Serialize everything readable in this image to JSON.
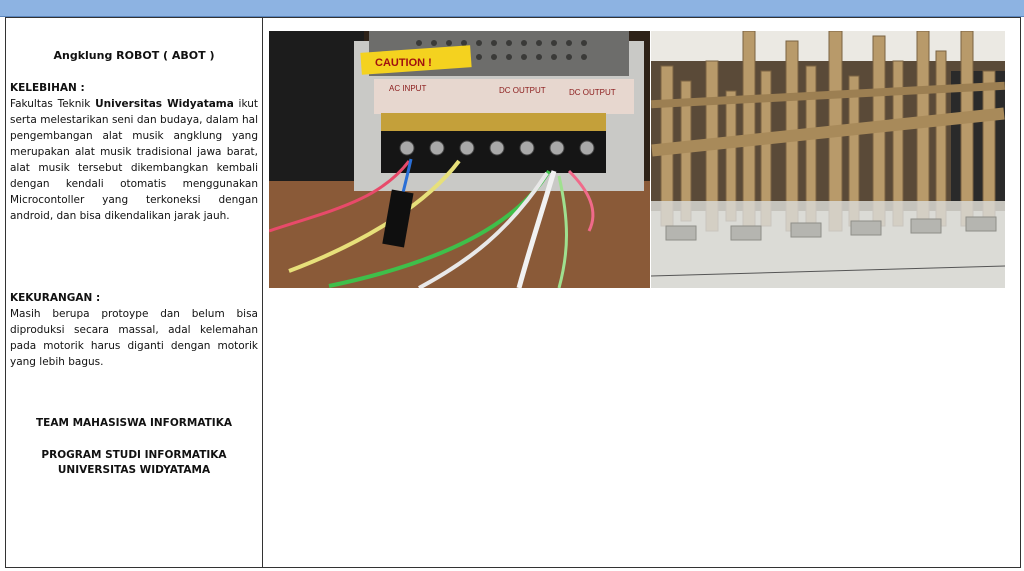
{
  "left_panel": {
    "title": "Angklung ROBOT  ( ABOT )",
    "kelebihan": {
      "heading": "KELEBIHAN  :",
      "text_before": "Fakultas Teknik ",
      "text_bold": "Universitas Widyatama",
      "text_after": " ikut serta melestarikan seni dan budaya, dalam hal pengembangan alat musik angklung  yang merupakan alat musik tradisional jawa barat, alat musik tersebut dikembangkan kembali dengan kendali otomatis  menggunakan Microcontoller yang terkoneksi dengan android, dan bisa dikendalikan jarak jauh."
    },
    "kekurangan": {
      "heading": "KEKURANGAN  :",
      "text": "Masih berupa protoype dan belum bisa diproduksi secara  massal, adal kelemahan pada motorik harus diganti dengan motorik yang lebih bagus."
    },
    "team": "TEAM MAHASISWA INFORMATIKA",
    "prodi_line1": "PROGRAM STUDI  INFORMATIKA",
    "prodi_line2": "UNIVERSITAS WIDYATAMA"
  },
  "photos": {
    "left": {
      "caution_label": "CAUTION !",
      "terminal_labels": [
        "AC INPUT",
        "DC OUTPUT",
        "DC OUTPUT"
      ]
    },
    "right": {}
  },
  "colors": {
    "top_bar": "#8db3e2",
    "border": "#333333"
  }
}
